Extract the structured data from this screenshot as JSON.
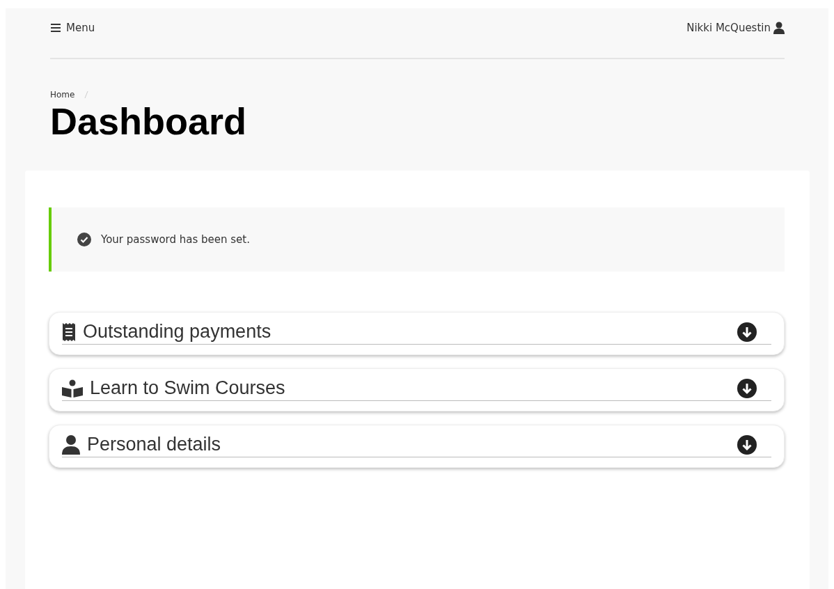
{
  "header": {
    "menu_label": "Menu",
    "user_name": "Nikki McQuestin"
  },
  "breadcrumb": [
    "Home"
  ],
  "page_title": "Dashboard",
  "alert": {
    "kind": "success",
    "message": "Your password has been set."
  },
  "sections": [
    {
      "kind": "receipt",
      "title": "Outstanding payments",
      "expanded": false
    },
    {
      "kind": "reader",
      "title": "Learn to Swim Courses",
      "expanded": false
    },
    {
      "kind": "user",
      "title": "Personal details",
      "expanded": false
    }
  ]
}
